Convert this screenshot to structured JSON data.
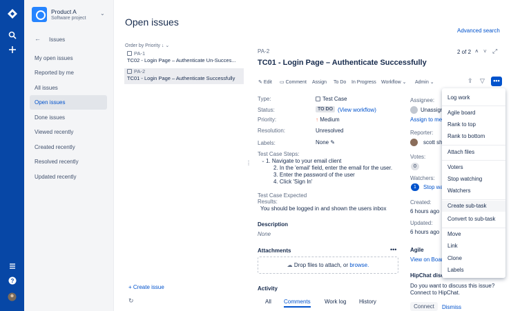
{
  "sidebar": {
    "project_name": "Product A",
    "project_type": "Software project",
    "back_label": "Issues",
    "items": [
      {
        "label": "My open issues"
      },
      {
        "label": "Reported by me"
      },
      {
        "label": "All issues"
      },
      {
        "label": "Open issues"
      },
      {
        "label": "Done issues"
      },
      {
        "label": "Viewed recently"
      },
      {
        "label": "Created recently"
      },
      {
        "label": "Resolved recently"
      },
      {
        "label": "Updated recently"
      }
    ]
  },
  "page": {
    "title": "Open issues",
    "advanced_search": "Advanced search"
  },
  "list": {
    "order_by": "Order by Priority",
    "issues": [
      {
        "key": "PA-1",
        "summary": "TC02 - Login Page – Authenticate Un-Succes..."
      },
      {
        "key": "PA-2",
        "summary": "TC01 - Login Page – Authenticate Successfully"
      }
    ],
    "create_issue": "+ Create issue"
  },
  "issue": {
    "key": "PA-2",
    "title": "TC01 - Login Page – Authenticate Successfully",
    "pager": "2 of 2",
    "toolbar": {
      "edit": "Edit",
      "comment": "Comment",
      "assign": "Assign",
      "todo": "To Do",
      "inprogress": "In Progress",
      "workflow": "Workflow",
      "admin": "Admin"
    },
    "fields": {
      "type_label": "Type:",
      "type_value": "Test Case",
      "status_label": "Status:",
      "status_value": "TO DO",
      "view_workflow": "(View workflow)",
      "priority_label": "Priority:",
      "priority_value": "Medium",
      "resolution_label": "Resolution:",
      "resolution_value": "Unresolved",
      "labels_label": "Labels:",
      "labels_value": "None"
    },
    "steps_label": "Test Case Steps:",
    "steps": [
      "1. Navigate to your email client",
      "2. In the 'email' field, enter the email for the user.",
      "3. Enter the password of the user",
      "4. Click 'Sign In'"
    ],
    "expected_label_1": "Test Case Expected",
    "expected_label_2": "Results:",
    "expected_value": "You should be logged in and shown the users inbox",
    "description_label": "Description",
    "description_value": "None",
    "attachments_label": "Attachments",
    "drop_text": "Drop files to attach, or ",
    "browse": "browse.",
    "activity_label": "Activity",
    "activity_tabs": [
      "All",
      "Comments",
      "Work log",
      "History"
    ]
  },
  "people": {
    "assignee_label": "Assignee:",
    "assignee_value": "Unassign",
    "assign_to_me": "Assign to me",
    "reporter_label": "Reporter:",
    "reporter_value": "scott sh",
    "votes_label": "Votes:",
    "votes_value": "0",
    "watchers_label": "Watchers:",
    "watchers_count": "1",
    "watchers_link": "Stop wa",
    "created_label": "Created:",
    "created_value": "6 hours ago",
    "updated_label": "Updated:",
    "updated_value": "6 hours ago",
    "agile_label": "Agile",
    "agile_link": "View on Boar",
    "hipchat_label": "HipChat discu",
    "hipchat_text_1": "Do you want to discuss this issue?",
    "hipchat_text_2": "Connect to HipChat.",
    "connect": "Connect",
    "dismiss": "Dismiss"
  },
  "menu": {
    "items": [
      "Log work",
      "Agile board",
      "Rank to top",
      "Rank to bottom",
      "Attach files",
      "Voters",
      "Stop watching",
      "Watchers",
      "Create sub-task",
      "Convert to sub-task",
      "Move",
      "Link",
      "Clone",
      "Labels"
    ]
  },
  "colors": {
    "nav": "#0747a6",
    "link": "#0052cc",
    "accent": "#2684ff"
  }
}
